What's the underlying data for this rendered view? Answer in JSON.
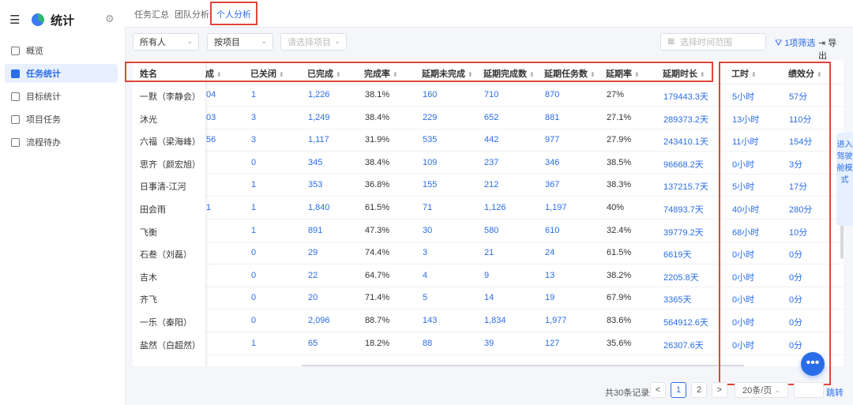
{
  "sidebar": {
    "title": "统计",
    "menu_icon": "menu-icon",
    "settings_icon": "gear-icon",
    "items": [
      {
        "label": "概览",
        "active": false
      },
      {
        "label": "任务统计",
        "active": true
      },
      {
        "label": "目标统计",
        "active": false
      },
      {
        "label": "项目任务",
        "active": false
      },
      {
        "label": "流程待办",
        "active": false
      }
    ]
  },
  "tabs": [
    {
      "label": "任务汇总"
    },
    {
      "label": "团队分析"
    },
    {
      "label": "个人分析"
    }
  ],
  "filters": {
    "person": "所有人",
    "group_by": "按项目",
    "project_placeholder": "请选择项目",
    "date_placeholder": "选择时间范围",
    "filter_label": "1项筛选",
    "export_label": "导出"
  },
  "table": {
    "headers": {
      "name": "姓名",
      "c0": "成",
      "closed": "已关闭",
      "done": "已完成",
      "rate": "完成率",
      "delayed_undone": "延期未完成",
      "delayed_done": "延期完成数",
      "delayed_tasks": "延期任务数",
      "delay_rate": "延期率",
      "delay_time": "延期时长",
      "hours": "工时",
      "score": "绩效分"
    },
    "rows": [
      {
        "name": "一默（李静会）",
        "c0": "04",
        "closed": "1",
        "done": "1,226",
        "rate": "38.1%",
        "du": "160",
        "dd": "710",
        "dt": "870",
        "dr": "27%",
        "dl": "179443.3天",
        "h": "5小时",
        "s": "57分"
      },
      {
        "name": "沐光",
        "c0": "03",
        "closed": "3",
        "done": "1,249",
        "rate": "38.4%",
        "du": "229",
        "dd": "652",
        "dt": "881",
        "dr": "27.1%",
        "dl": "289373.2天",
        "h": "13小时",
        "s": "110分"
      },
      {
        "name": "六福（梁海峰）",
        "c0": "56",
        "closed": "3",
        "done": "1,117",
        "rate": "31.9%",
        "du": "535",
        "dd": "442",
        "dt": "977",
        "dr": "27.9%",
        "dl": "243410.1天",
        "h": "11小时",
        "s": "154分"
      },
      {
        "name": "思齐（颜宏旭）",
        "c0": "",
        "closed": "0",
        "done": "345",
        "rate": "38.4%",
        "du": "109",
        "dd": "237",
        "dt": "346",
        "dr": "38.5%",
        "dl": "96668.2天",
        "h": "0小时",
        "s": "3分"
      },
      {
        "name": "日事清-江河",
        "c0": "",
        "closed": "1",
        "done": "353",
        "rate": "36.8%",
        "du": "155",
        "dd": "212",
        "dt": "367",
        "dr": "38.3%",
        "dl": "137215.7天",
        "h": "5小时",
        "s": "17分"
      },
      {
        "name": "田会雨",
        "c0": "1",
        "closed": "1",
        "done": "1,840",
        "rate": "61.5%",
        "du": "71",
        "dd": "1,126",
        "dt": "1,197",
        "dr": "40%",
        "dl": "74893.7天",
        "h": "40小时",
        "s": "280分"
      },
      {
        "name": "飞衡",
        "c0": "",
        "closed": "1",
        "done": "891",
        "rate": "47.3%",
        "du": "30",
        "dd": "580",
        "dt": "610",
        "dr": "32.4%",
        "dl": "39779.2天",
        "h": "68小时",
        "s": "10分"
      },
      {
        "name": "石叁（刘磊）",
        "c0": "",
        "closed": "0",
        "done": "29",
        "rate": "74.4%",
        "du": "3",
        "dd": "21",
        "dt": "24",
        "dr": "61.5%",
        "dl": "6619天",
        "h": "0小时",
        "s": "0分"
      },
      {
        "name": "吉木",
        "c0": "",
        "closed": "0",
        "done": "22",
        "rate": "64.7%",
        "du": "4",
        "dd": "9",
        "dt": "13",
        "dr": "38.2%",
        "dl": "2205.8天",
        "h": "0小时",
        "s": "0分"
      },
      {
        "name": "齐飞",
        "c0": "",
        "closed": "0",
        "done": "20",
        "rate": "71.4%",
        "du": "5",
        "dd": "14",
        "dt": "19",
        "dr": "67.9%",
        "dl": "3365天",
        "h": "0小时",
        "s": "0分"
      },
      {
        "name": "一乐（秦阳）",
        "c0": "",
        "closed": "0",
        "done": "2,096",
        "rate": "88.7%",
        "du": "143",
        "dd": "1,834",
        "dt": "1,977",
        "dr": "83.6%",
        "dl": "564912.6天",
        "h": "0小时",
        "s": "0分"
      },
      {
        "name": "盐然（白超然）",
        "c0": "",
        "closed": "1",
        "done": "65",
        "rate": "18.2%",
        "du": "88",
        "dd": "39",
        "dt": "127",
        "dr": "35.6%",
        "dl": "26307.6天",
        "h": "0小时",
        "s": "0分"
      }
    ]
  },
  "side_tab": "进入驾驶舱模式",
  "fab_icon": "more-icon",
  "pagination": {
    "total": "共30条记录",
    "prev": "<",
    "next": ">",
    "pages": [
      "1",
      "2"
    ],
    "current": "1",
    "page_size": "20条/页",
    "goto": "跳转"
  },
  "colors": {
    "accent": "#2b6de8",
    "annotation": "#e0453a"
  }
}
